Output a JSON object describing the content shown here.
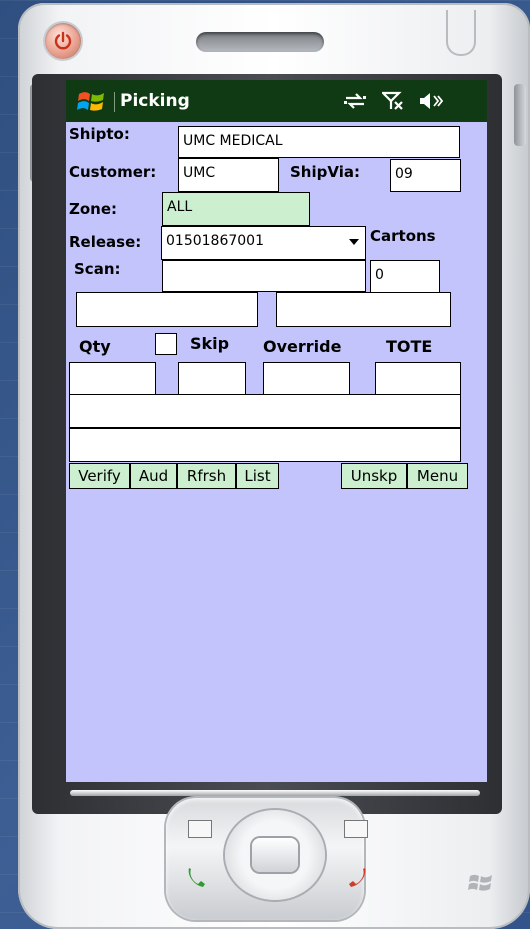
{
  "device": {
    "power_icon": "power-icon",
    "call_icon": "call-green-icon",
    "end_icon": "call-red-icon",
    "windows_logo": "windows-logo-icon"
  },
  "titlebar": {
    "title": "Picking",
    "icons": [
      "sync-arrows-icon",
      "signal-off-icon",
      "speaker-icon"
    ]
  },
  "form": {
    "shipto_label": "Shipto:",
    "shipto_value": "UMC MEDICAL",
    "customer_label": "Customer:",
    "customer_value": "UMC",
    "shipvia_label": "ShipVia:",
    "shipvia_value": "09",
    "zone_label": "Zone:",
    "zone_value": "ALL",
    "release_label": "Release:",
    "release_value": "01501867001",
    "cartons_label": "Cartons",
    "cartons_value": "0",
    "scan_label": "Scan:",
    "scan_value": "",
    "qty_label": "Qty",
    "skip_label": "Skip",
    "override_label": "Override",
    "tote_label": "TOTE"
  },
  "buttons": {
    "verify": "Verify",
    "aud": "Aud",
    "rfrsh": "Rfrsh",
    "list": "List",
    "unskp": "Unskp",
    "menu": "Menu"
  },
  "colors": {
    "screen_bg": "#c4c4fc",
    "titlebar_bg": "#0f3a14",
    "button_bg": "#ccefcf"
  }
}
